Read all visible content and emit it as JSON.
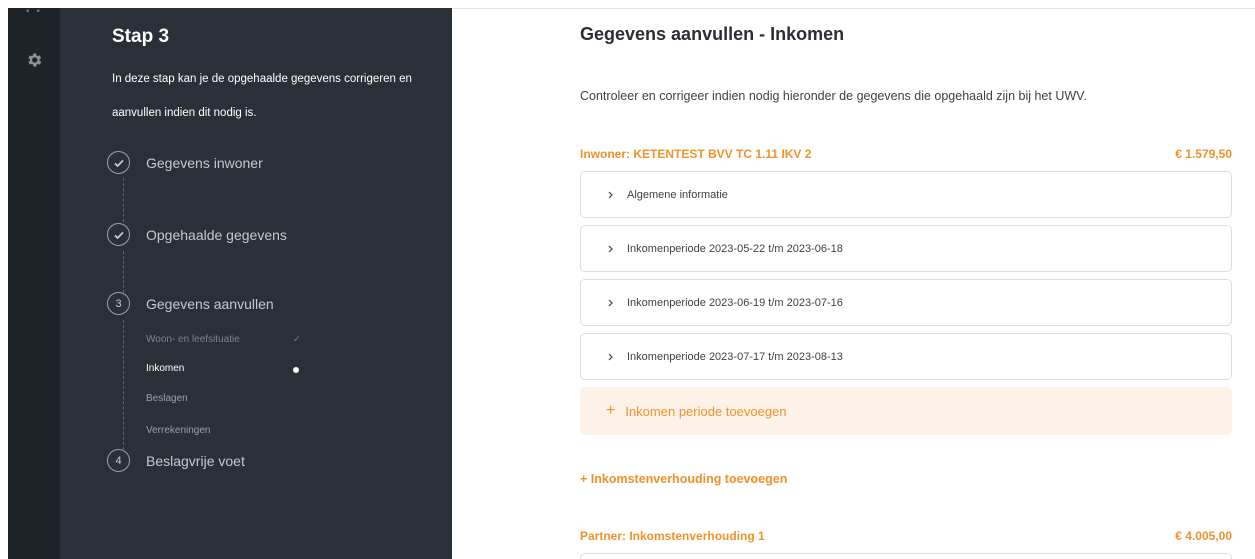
{
  "rail": {
    "icons": [
      "grid-icon",
      "gear-icon"
    ]
  },
  "steps_panel": {
    "title": "Stap 3",
    "description": "In deze stap kan je de opgehaalde gegevens corrigeren en aanvullen indien dit nodig is.",
    "steps": [
      {
        "marker": "check",
        "label": "Gegevens inwoner"
      },
      {
        "marker": "check",
        "label": "Opgehaalde gegevens"
      },
      {
        "marker": "3",
        "label": "Gegevens aanvullen"
      },
      {
        "marker": "4",
        "label": "Beslagvrije voet"
      }
    ],
    "substeps": [
      {
        "label": "Woon- en leefsituatie",
        "state": "done"
      },
      {
        "label": "Inkomen",
        "state": "active"
      },
      {
        "label": "Beslagen",
        "state": "todo"
      },
      {
        "label": "Verrekeningen",
        "state": "todo"
      }
    ]
  },
  "main": {
    "heading": "Gegevens aanvullen - Inkomen",
    "intro": "Controleer en corrigeer indien nodig hieronder de gegevens die opgehaald zijn bij het UWV.",
    "inwoner": {
      "title": "Inwoner: KETENTEST BVV TC 1.11 IKV 2",
      "amount": "€ 1.579,50",
      "accordions": [
        "Algemene informatie",
        "Inkomenperiode 2023-05-22 t/m 2023-06-18",
        "Inkomenperiode 2023-06-19 t/m 2023-07-16",
        "Inkomenperiode 2023-07-17 t/m 2023-08-13"
      ],
      "add_period_label": "Inkomen periode toevoegen"
    },
    "add_relation_label": "+ Inkomstenverhouding toevoegen",
    "partner": {
      "title": "Partner: Inkomstenverhouding 1",
      "amount": "€ 4.005,00"
    }
  },
  "colors": {
    "accent": "#f0922b",
    "panel": "#2a3037",
    "rail": "#1e2328"
  }
}
